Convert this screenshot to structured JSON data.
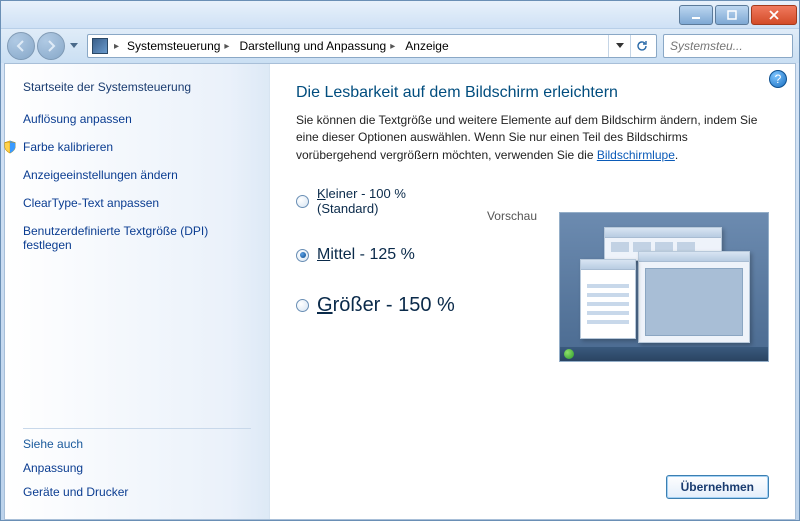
{
  "titlebar": {
    "minimize": "minimize",
    "maximize": "maximize",
    "close": "close"
  },
  "breadcrumb": {
    "items": [
      "Systemsteuerung",
      "Darstellung und Anpassung",
      "Anzeige"
    ]
  },
  "search": {
    "placeholder": "Systemsteu..."
  },
  "sidebar": {
    "home": "Startseite der Systemsteuerung",
    "tasks": [
      "Auflösung anpassen",
      "Farbe kalibrieren",
      "Anzeigeeinstellungen ändern",
      "ClearType-Text anpassen",
      "Benutzerdefinierte Textgröße (DPI) festlegen"
    ],
    "seealso_header": "Siehe auch",
    "seealso": [
      "Anpassung",
      "Geräte und Drucker"
    ]
  },
  "main": {
    "heading": "Die Lesbarkeit auf dem Bildschirm erleichtern",
    "desc_pre": "Sie können die Textgröße und weitere Elemente auf dem Bildschirm ändern, indem Sie eine dieser Optionen auswählen. Wenn Sie nur einen Teil des Bildschirms vorübergehend vergrößern möchten, verwenden Sie die ",
    "desc_link": "Bildschirmlupe",
    "desc_post": ".",
    "options": {
      "small_prefix": "K",
      "small_rest": "leiner - 100 % (Standard)",
      "medium_prefix": "M",
      "medium_rest": "ittel - 125 %",
      "large_prefix": "G",
      "large_rest": "rößer - 150 %",
      "selected": "medium"
    },
    "preview_label": "Vorschau",
    "apply": "Übernehmen",
    "help": "?"
  }
}
